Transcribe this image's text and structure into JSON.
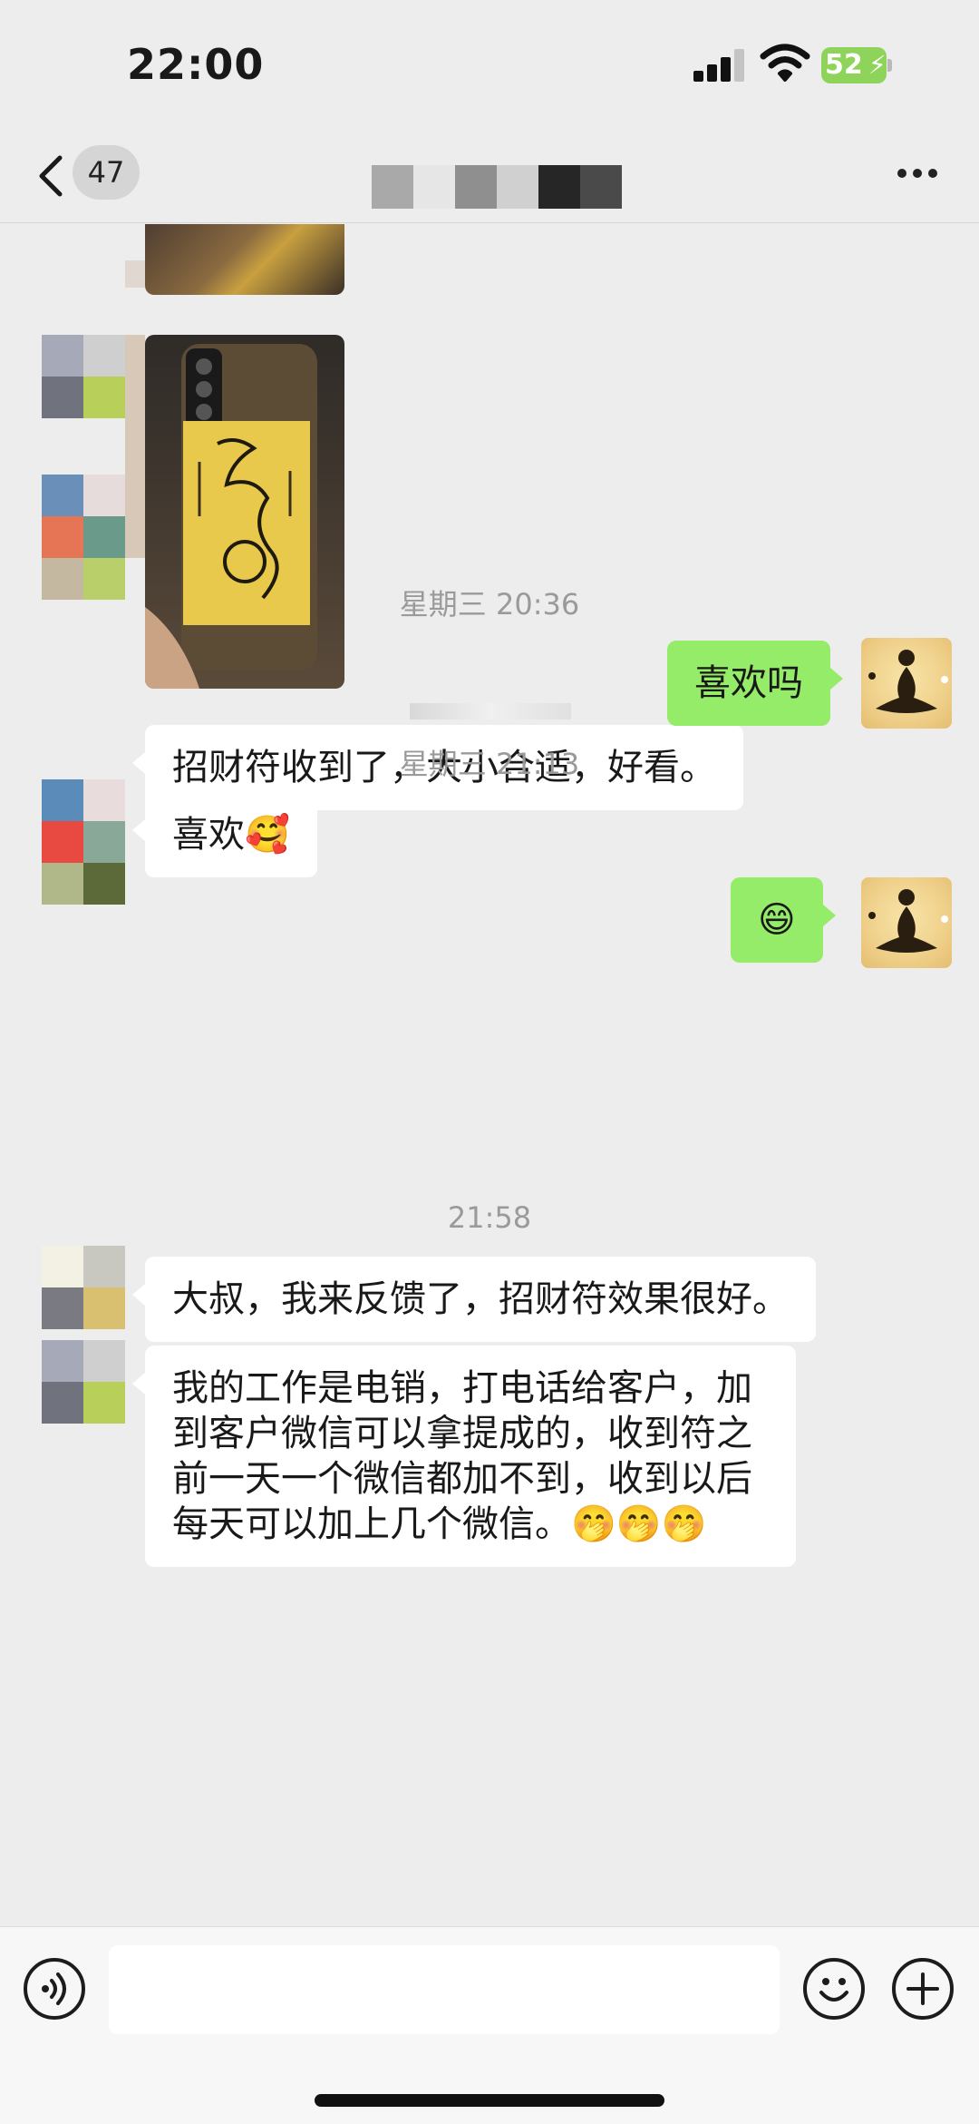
{
  "status_bar": {
    "time": "22:00",
    "battery_percent": "52"
  },
  "nav": {
    "unread_count": "47"
  },
  "messages": [
    {
      "side": "left",
      "type": "text",
      "text": "招财符收到了，大小合适，好看。"
    },
    {
      "type": "timestamp",
      "text": "星期三 20:36"
    },
    {
      "side": "right",
      "type": "text",
      "text": "喜欢吗"
    },
    {
      "type": "timestamp",
      "text": "星期三 21:13"
    },
    {
      "side": "left",
      "type": "text",
      "text": "喜欢🥰"
    },
    {
      "side": "right",
      "type": "text",
      "text": "😄"
    },
    {
      "type": "timestamp",
      "text": "21:58"
    },
    {
      "side": "left",
      "type": "text",
      "text": "大叔，我来反馈了，招财符效果很好。"
    },
    {
      "side": "left",
      "type": "text",
      "text": "我的工作是电销，打电话给客户，加到客户微信可以拿提成的，收到符之前一天一个微信都加不到，收到以后每天可以加上几个微信。🤭🤭🤭"
    }
  ],
  "message_lines": {
    "m8": [
      "我的工作是电销，打电话给客户，加",
      "到客户微信可以拿提成的，收到符之",
      "前一天一个微信都加不到，收到以后",
      "每天可以加上几个微信。🤭🤭🤭"
    ]
  },
  "colors": {
    "background": "#ededed",
    "bubble_self": "#95ec69",
    "bubble_other": "#ffffff",
    "battery": "#8ed45a"
  },
  "icons": {
    "back": "chevron-left-icon",
    "more": "ellipsis-icon",
    "voice": "voice-icon",
    "emoji": "emoji-icon",
    "add": "plus-icon"
  }
}
